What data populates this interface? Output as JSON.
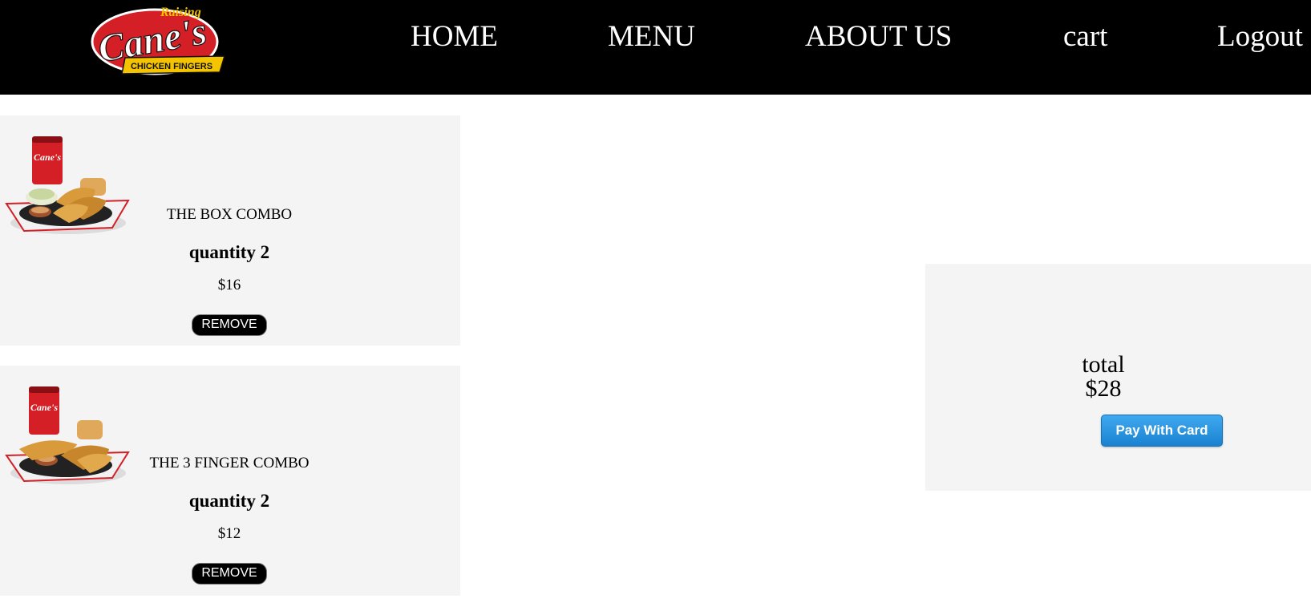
{
  "header": {
    "logo": {
      "script_top": "Raising",
      "script_main": "Cane's",
      "banner": "CHICKEN FINGERS"
    },
    "nav": {
      "home": "HOME",
      "menu": "MENU",
      "about": "ABOUT US",
      "cart": "cart",
      "logout": "Logout"
    }
  },
  "cart": {
    "items": [
      {
        "name": "THE BOX COMBO",
        "quantity": "quantity 2",
        "price": "$16",
        "remove_label": "REMOVE"
      },
      {
        "name": "THE 3 FINGER COMBO",
        "quantity": "quantity 2",
        "price": "$12",
        "remove_label": "REMOVE"
      }
    ]
  },
  "summary": {
    "total_label": "total",
    "total_value": "$28",
    "pay_label": "Pay With Card"
  },
  "colors": {
    "header_bg": "#000000",
    "panel_bg": "#f4f4f4",
    "brand_red": "#d41f26",
    "brand_yellow": "#f5c400",
    "pay_button": "#1f8ad6"
  }
}
